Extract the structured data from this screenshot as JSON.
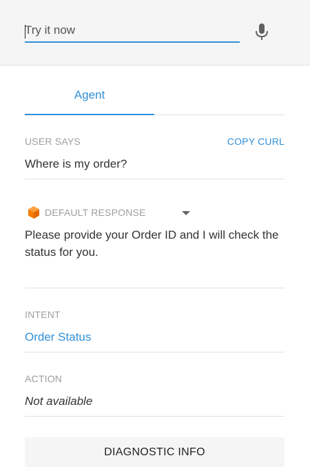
{
  "search": {
    "placeholder": "Try it now",
    "value": ""
  },
  "icons": {
    "mic": "microphone-icon",
    "response": "cube-icon",
    "dropdown": "dropdown-arrow-icon"
  },
  "colors": {
    "accent": "#2f8fd8",
    "cube": "#f57c00",
    "muted": "#9e9e9e"
  },
  "tabs": [
    {
      "label": "Agent",
      "active": true
    }
  ],
  "user_says": {
    "label": "USER SAYS",
    "copy_label": "COPY CURL",
    "value": "Where is my order?"
  },
  "response": {
    "label": "DEFAULT RESPONSE",
    "text": "Please provide your Order ID and I will check the status for you."
  },
  "intent": {
    "label": "INTENT",
    "value": "Order Status"
  },
  "action": {
    "label": "ACTION",
    "value": "Not available"
  },
  "diagnostic": {
    "label": "DIAGNOSTIC INFO"
  }
}
